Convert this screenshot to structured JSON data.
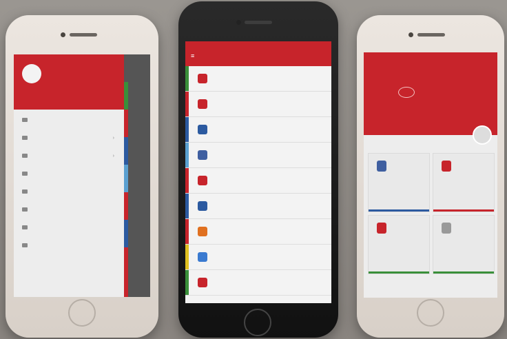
{
  "left_phone": {
    "drawer_user": "",
    "menu_items": [
      {
        "label": ""
      },
      {
        "label": ""
      },
      {
        "label": ""
      },
      {
        "label": ""
      },
      {
        "label": ""
      },
      {
        "label": ""
      },
      {
        "label": ""
      },
      {
        "label": ""
      }
    ]
  },
  "middle_phone": {
    "title": "",
    "services": [
      {
        "label": "",
        "color": "#c7242b",
        "bar": "#3a8f3a"
      },
      {
        "label": "",
        "color": "#c7242b",
        "bar": "#c7242b"
      },
      {
        "label": "",
        "color": "#2c5aa0",
        "bar": "#2c5aa0"
      },
      {
        "label": "",
        "color": "#3f5fa0",
        "bar": "#5aa0d0"
      },
      {
        "label": "",
        "color": "#c7242b",
        "bar": "#c7242b"
      },
      {
        "label": "",
        "color": "#2c5aa0",
        "bar": "#2c5aa0"
      },
      {
        "label": "",
        "color": "#e07020",
        "bar": "#c7242b"
      },
      {
        "label": "",
        "color": "#3a7ad0",
        "bar": "#e0c020"
      },
      {
        "label": "",
        "color": "#c7242b",
        "bar": "#3a8f3a"
      }
    ]
  },
  "right_phone": {
    "brand": "",
    "subtitle": "",
    "section_title": "",
    "cards": [
      {
        "title": "",
        "color": "#3f5fa0",
        "line": "#2c5aa0"
      },
      {
        "title": "",
        "color": "#c7242b",
        "line": "#c7242b"
      },
      {
        "title": "",
        "color": "#c7242b",
        "line": "#3a8f3a"
      },
      {
        "title": "",
        "color": "#999999",
        "line": "#3a8f3a"
      }
    ]
  }
}
